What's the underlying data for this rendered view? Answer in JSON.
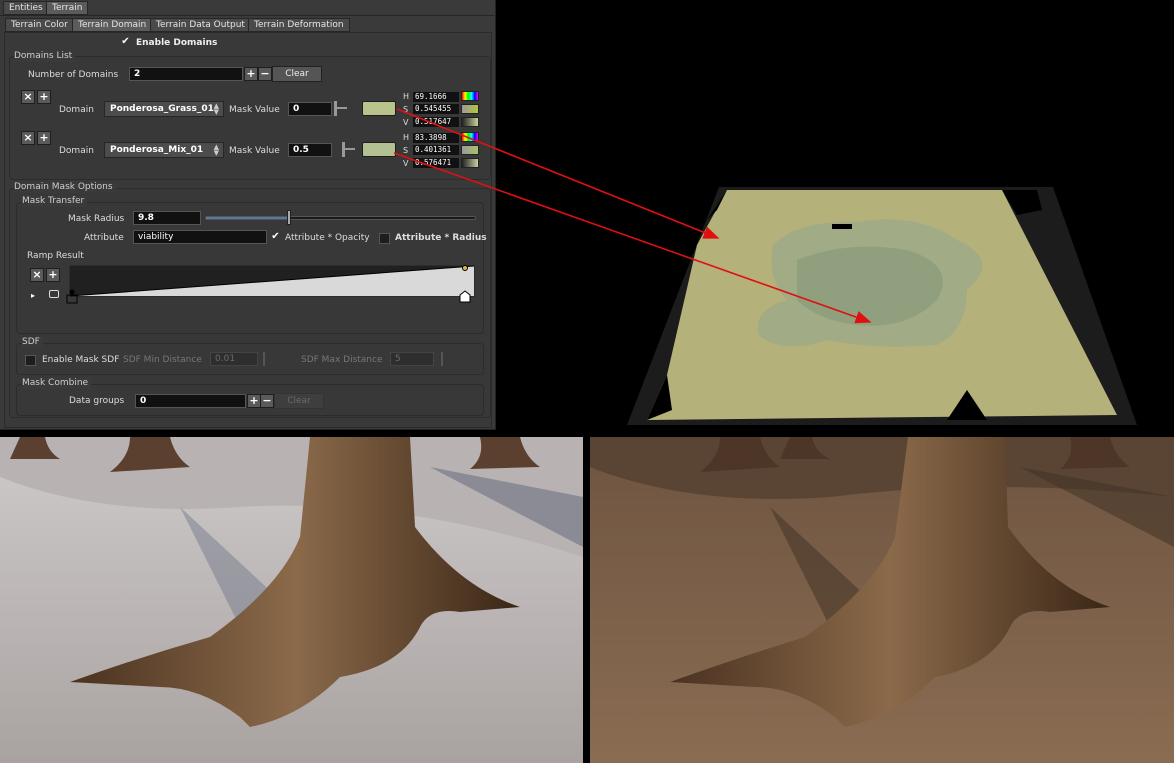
{
  "colors": {
    "swatch_1": "#b9c48c",
    "swatch_2": "#b3c092",
    "terrain_base": "#b5b17a"
  },
  "top_tabs": [
    "Entities",
    "Terrain"
  ],
  "sub_tabs": [
    "Terrain Color",
    "Terrain Domain",
    "Terrain Data Output",
    "Terrain Deformation"
  ],
  "enable_domains": {
    "label": "Enable Domains",
    "checked": true
  },
  "domains_list": {
    "title": "Domains List",
    "count_label": "Number of Domains",
    "count_value": "2",
    "clear_label": "Clear",
    "rows": [
      {
        "domain_label": "Domain",
        "domain_value": "Ponderosa_Grass_01",
        "mask_label": "Mask Value",
        "mask_value": "0",
        "h": "69.1666",
        "s": "0.545455",
        "v": "0.517647"
      },
      {
        "domain_label": "Domain",
        "domain_value": "Ponderosa_Mix_01",
        "mask_label": "Mask Value",
        "mask_value": "0.5",
        "h": "83.3898",
        "s": "0.401361",
        "v": "0.576471"
      }
    ],
    "hsv_labels": [
      "H",
      "S",
      "V"
    ]
  },
  "mask_options": {
    "title": "Domain Mask Options",
    "transfer_title": "Mask Transfer",
    "radius_label": "Mask Radius",
    "radius_value": "9.8",
    "radius_fraction": 0.31,
    "attribute_label": "Attribute",
    "attribute_value": "viability",
    "opacity_label": "Attribute * Opacity",
    "opacity_checked": true,
    "radius_mult_label": "Attribute * Radius",
    "radius_mult_checked": false,
    "ramp_title": "Ramp Result"
  },
  "sdf": {
    "title": "SDF",
    "enable_label": "Enable Mask SDF",
    "min_label": "SDF Min Distance",
    "min_value": "0.01",
    "max_label": "SDF Max Distance",
    "max_value": "5"
  },
  "mask_combine": {
    "title": "Mask Combine",
    "groups_label": "Data groups",
    "groups_value": "0",
    "clear_label": "Clear"
  },
  "icons": [
    "close-icon",
    "plus-icon",
    "minus-icon",
    "checkmark-icon",
    "dropdown-arrow-icon",
    "play-icon",
    "link-icon"
  ]
}
